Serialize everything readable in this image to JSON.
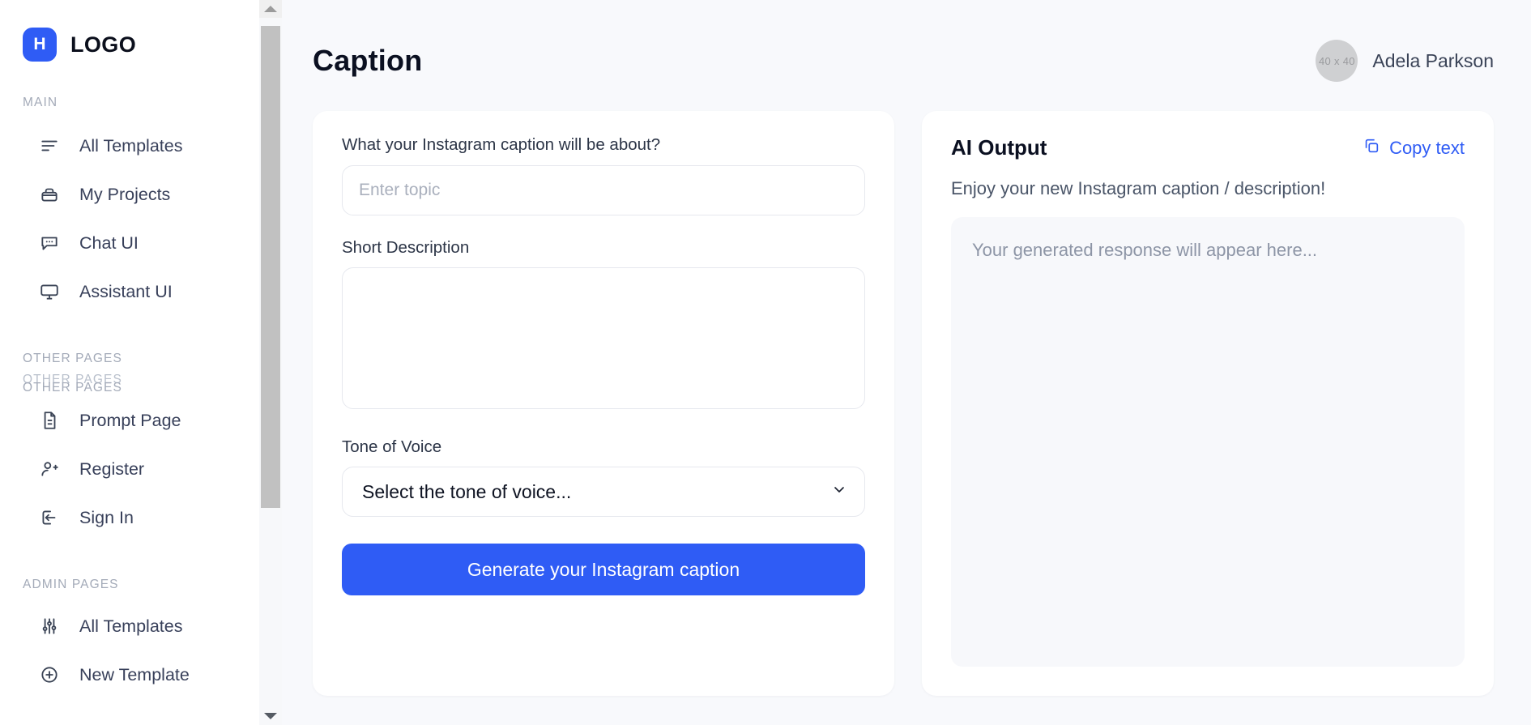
{
  "brand": {
    "mark": "H",
    "name": "LOGO"
  },
  "sidebar": {
    "sections": [
      {
        "label": "MAIN"
      },
      {
        "label": "OTHER PAGES"
      },
      {
        "label": "OTHER PAGES"
      },
      {
        "label": "ADMIN PAGES"
      }
    ],
    "main_items": [
      {
        "label": "All Templates",
        "icon": "list-lines-icon"
      },
      {
        "label": "My Projects",
        "icon": "briefcase-icon"
      },
      {
        "label": "Chat UI",
        "icon": "chat-bubble-icon"
      },
      {
        "label": "Assistant UI",
        "icon": "monitor-icon"
      }
    ],
    "other_items": [
      {
        "label": "Prompt Page",
        "icon": "document-icon"
      },
      {
        "label": "Register",
        "icon": "user-plus-icon"
      },
      {
        "label": "Sign In",
        "icon": "sign-in-icon"
      }
    ],
    "admin_items": [
      {
        "label": "All Templates",
        "icon": "sliders-icon"
      },
      {
        "label": "New Template",
        "icon": "plus-circle-icon"
      }
    ],
    "scrollbar": {
      "up_icon": "caret-up-icon",
      "down_icon": "caret-down-icon"
    }
  },
  "header": {
    "title": "Caption",
    "user": {
      "name": "Adela Parkson",
      "avatar_text": "40 x 40"
    }
  },
  "form": {
    "topic_label": "What your Instagram caption will be about?",
    "topic_placeholder": "Enter topic",
    "topic_value": "",
    "description_label": "Short Description",
    "description_placeholder": "",
    "description_value": "",
    "tone_label": "Tone of Voice",
    "tone_selected": "Select the tone of voice...",
    "tone_options": [
      "Select the tone of voice..."
    ],
    "submit_label": "Generate your Instagram caption"
  },
  "output": {
    "title": "AI Output",
    "copy_label": "Copy text",
    "copy_icon": "copy-icon",
    "subtitle": "Enjoy your new Instagram caption / description!",
    "placeholder": "Your generated response will appear here..."
  },
  "colors": {
    "accent": "#2f5cf5",
    "page_bg": "#f8f9fc",
    "card_bg": "#ffffff",
    "text": "#0b1021",
    "muted": "#8d95a6"
  }
}
